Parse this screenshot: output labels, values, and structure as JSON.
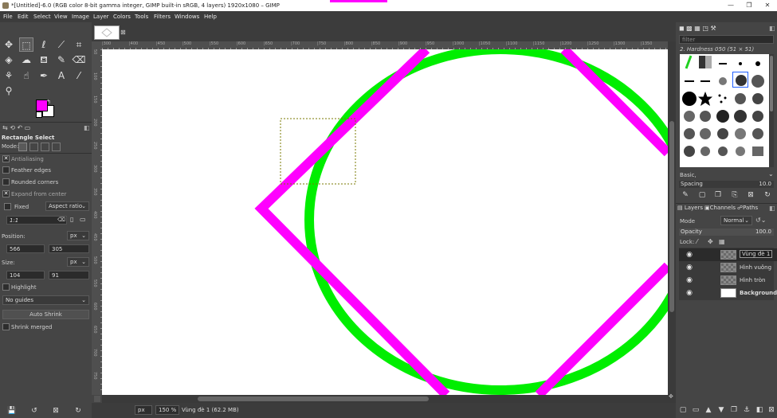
{
  "window": {
    "title": "*[Untitled]-6.0 (RGB color 8-bit gamma integer, GIMP built-in sRGB, 4 layers) 1920x1080 – GIMP",
    "minimize": "—",
    "restore": "❐",
    "close": "✕"
  },
  "menubar": [
    "File",
    "Edit",
    "Select",
    "View",
    "Image",
    "Layer",
    "Colors",
    "Tools",
    "Filters",
    "Windows",
    "Help"
  ],
  "toolbox": {
    "tools": [
      "move-icon",
      "rect-select-icon",
      "lasso-icon",
      "fuzzy-select-icon",
      "crop-icon",
      "unified-transform-icon",
      "warp-icon",
      "paint-bucket-icon",
      "paintbrush-icon",
      "eraser-icon",
      "clone-icon",
      "smudge-icon",
      "paths-icon",
      "text-icon",
      "color-picker-icon",
      "zoom-icon"
    ],
    "fg_color": "#ff00ff",
    "bg_color": "#ffffff"
  },
  "tool_options": {
    "title": "Rectangle Select",
    "mode_label": "Mode:",
    "antialiasing": "Antialiasing",
    "feather_edges": "Feather edges",
    "rounded_corners": "Rounded corners",
    "expand_from_center": "Expand from center",
    "fixed_label": "Fixed",
    "fixed_value": "Aspect ratio",
    "ratio_value": "1:1",
    "position_label": "Position:",
    "position_unit": "px",
    "pos_x": "566",
    "pos_y": "305",
    "size_label": "Size:",
    "size_unit": "px",
    "size_w": "104",
    "size_h": "91",
    "highlight": "Highlight",
    "guides": "No guides",
    "auto_shrink": "Auto Shrink",
    "shrink_merged": "Shrink merged"
  },
  "ruler_top_labels": [
    "|300",
    "|400",
    "|450",
    "|500",
    "|550",
    "|600",
    "|650",
    "|700",
    "|750",
    "|800",
    "|850",
    "|900",
    "|950",
    "|1000",
    "|1050",
    "|1100",
    "|1150",
    "|1200",
    "|1250",
    "|1300",
    "|1350"
  ],
  "ruler_left_labels": [
    "50",
    "100",
    "150",
    "200",
    "250",
    "300",
    "350",
    "400",
    "450",
    "500",
    "550",
    "600",
    "650",
    "700",
    "750"
  ],
  "status": {
    "unit": "px",
    "zoom": "150 %",
    "message": "Vùng đè 1 (62.2 MB)"
  },
  "brushes": {
    "filter_placeholder": "filter",
    "current_brush": "2. Hardness 050 (51 × 51)",
    "tag": "Basic,",
    "spacing_label": "Spacing",
    "spacing_value": "10.0"
  },
  "layers_panel": {
    "tabs": [
      "Layers",
      "Channels",
      "Paths"
    ],
    "mode_label": "Mode",
    "mode_value": "Normal",
    "opacity_label": "Opacity",
    "opacity_value": "100.0",
    "lock_label": "Lock:",
    "layers": [
      {
        "name": "Vùng đè 1",
        "bold": false,
        "thumb": "checker"
      },
      {
        "name": "Hình vuông",
        "bold": false,
        "thumb": "checker"
      },
      {
        "name": "Hình tròn",
        "bold": false,
        "thumb": "checker"
      },
      {
        "name": "Background",
        "bold": true,
        "thumb": "white"
      }
    ]
  },
  "colors": {
    "square_stroke": "#ff00ff",
    "circle_stroke": "#00ee00",
    "selection": "#7a7a00"
  }
}
